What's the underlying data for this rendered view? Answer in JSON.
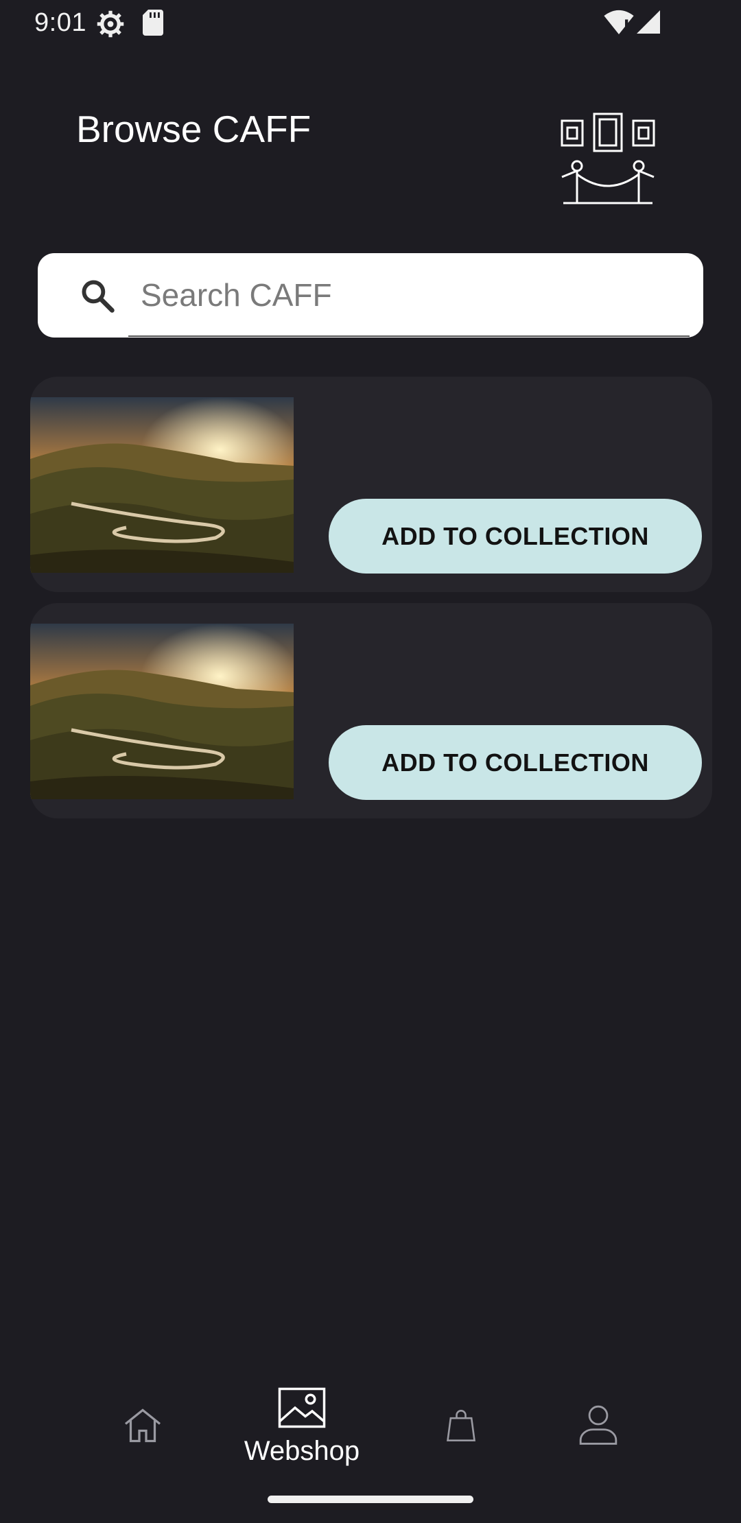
{
  "status_bar": {
    "time": "9:01",
    "icons": [
      "settings-icon",
      "sd-card-icon",
      "wifi-alert-icon",
      "cell-signal-icon"
    ]
  },
  "header": {
    "title": "Browse CAFF",
    "logo_icon": "gallery-exhibit-icon"
  },
  "search": {
    "placeholder": "Search CAFF",
    "value": "",
    "icon": "search-icon"
  },
  "results": [
    {
      "image": "landscape-thumbnail",
      "button_label": "ADD TO COLLECTION"
    },
    {
      "image": "landscape-thumbnail",
      "button_label": "ADD TO COLLECTION"
    }
  ],
  "bottom_nav": {
    "items": [
      {
        "icon": "home-icon",
        "label": ""
      },
      {
        "icon": "image-icon",
        "label": "Webshop",
        "active": true
      },
      {
        "icon": "shopping-bag-icon",
        "label": ""
      },
      {
        "icon": "person-icon",
        "label": ""
      }
    ]
  },
  "colors": {
    "background": "#1d1c22",
    "card": "#26252b",
    "button": "#c9e6e7",
    "search_bg": "#ffffff"
  }
}
